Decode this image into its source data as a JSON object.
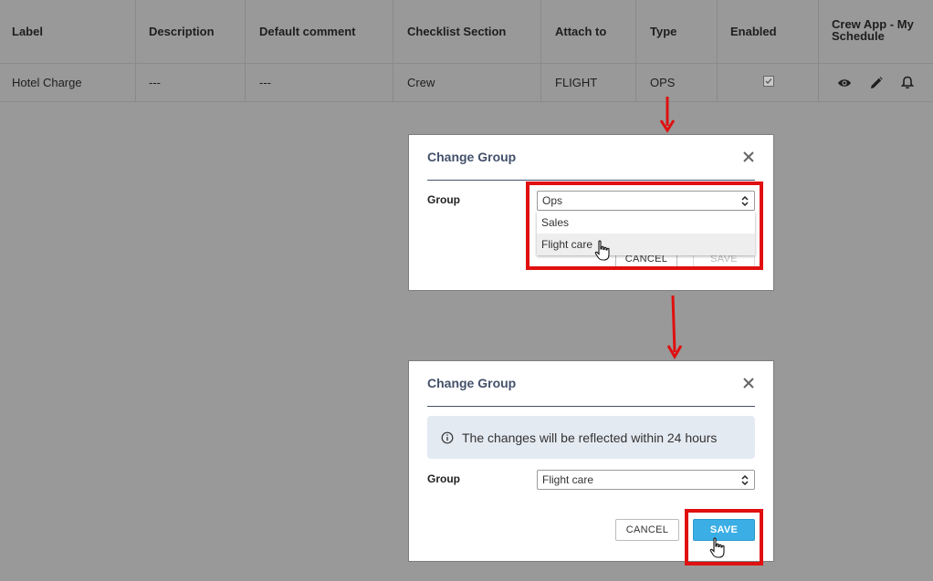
{
  "table": {
    "headers": [
      "Label",
      "Description",
      "Default comment",
      "Checklist Section",
      "Attach to",
      "Type",
      "Enabled",
      "Crew App - My Schedule"
    ],
    "row": {
      "label": "Hotel Charge",
      "description": "---",
      "default_comment": "---",
      "checklist_section": "Crew",
      "attach_to": "FLIGHT",
      "type": "OPS",
      "enabled": true
    },
    "actions": [
      "eye-icon",
      "pencil-icon",
      "bell-icon"
    ]
  },
  "dialog1": {
    "title": "Change Group",
    "group_label": "Group",
    "select_value": "Ops",
    "options": [
      "Sales",
      "Flight care"
    ],
    "hovered_option": "Flight care",
    "cancel_label": "CANCEL",
    "save_label": "SAVE",
    "save_enabled": false
  },
  "dialog2": {
    "title": "Change Group",
    "info_text": "The changes will be reflected within 24 hours",
    "group_label": "Group",
    "select_value": "Flight care",
    "cancel_label": "CANCEL",
    "save_label": "SAVE",
    "save_enabled": true
  },
  "colors": {
    "backdrop": "#999999",
    "title": "#44516b",
    "primary": "#3aaee5",
    "highlight": "#e01010",
    "info_bg": "#e4eaf2"
  }
}
